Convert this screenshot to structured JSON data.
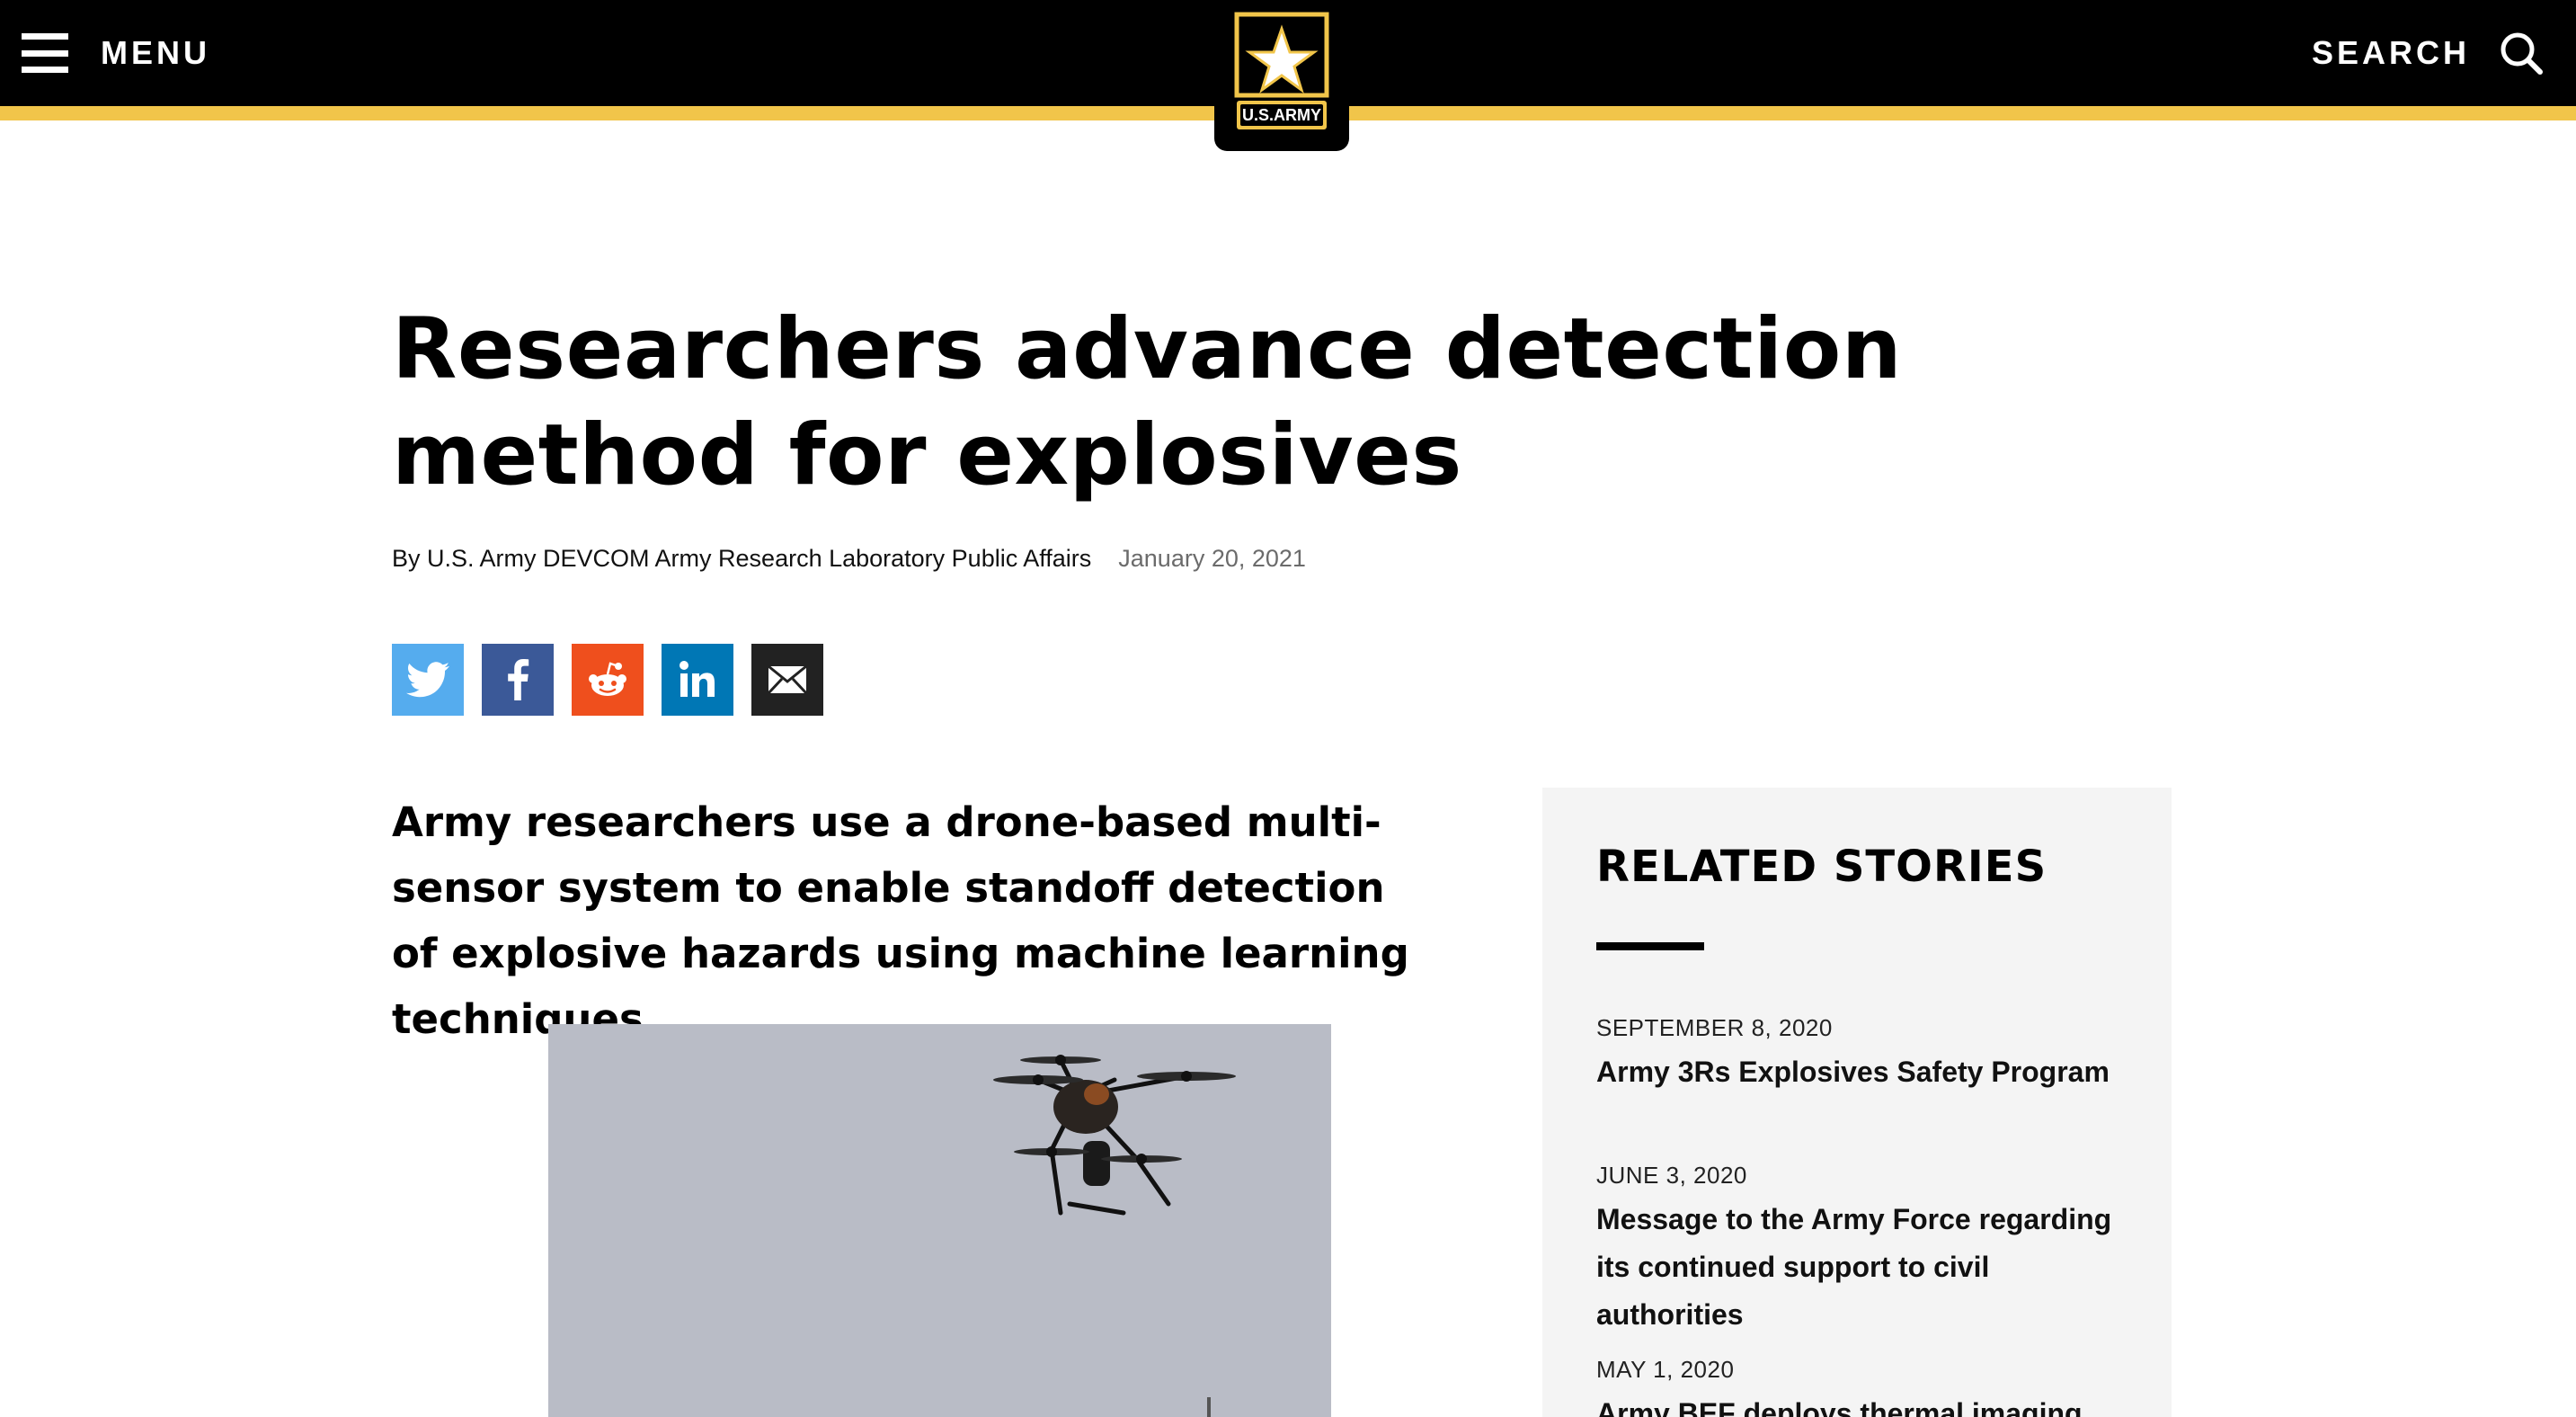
{
  "header": {
    "menu_label": "MENU",
    "search_label": "SEARCH",
    "logo_text": "U.S.ARMY",
    "stripe_color": "#f1c54a",
    "bar_color": "#000000"
  },
  "article": {
    "title": "Researchers advance detection method for explosives",
    "byline": "By U.S. Army DEVCOM Army Research Laboratory Public Affairs",
    "date": "January 20, 2021",
    "lead": "Army researchers use a drone-based multi-sensor system to enable standoff detection of explosive hazards using machine learning techniques"
  },
  "share": [
    {
      "name": "twitter",
      "icon": "twitter-icon",
      "color": "#55acee"
    },
    {
      "name": "facebook",
      "icon": "facebook-icon",
      "color": "#3b5998"
    },
    {
      "name": "reddit",
      "icon": "reddit-icon",
      "color": "#ef4f1d"
    },
    {
      "name": "linkedin",
      "icon": "linkedin-icon",
      "color": "#0077b5"
    },
    {
      "name": "email",
      "icon": "email-icon",
      "color": "#222222"
    }
  ],
  "related": {
    "title": "RELATED STORIES",
    "items": [
      {
        "date": "SEPTEMBER 8, 2020",
        "title": "Army 3Rs Explosives Safety Program"
      },
      {
        "date": "JUNE 3, 2020",
        "title": "Message to the Army Force regarding its continued support to civil authorities"
      },
      {
        "date": "MAY 1, 2020",
        "title": "Army BEF deploys thermal imaging"
      }
    ]
  }
}
